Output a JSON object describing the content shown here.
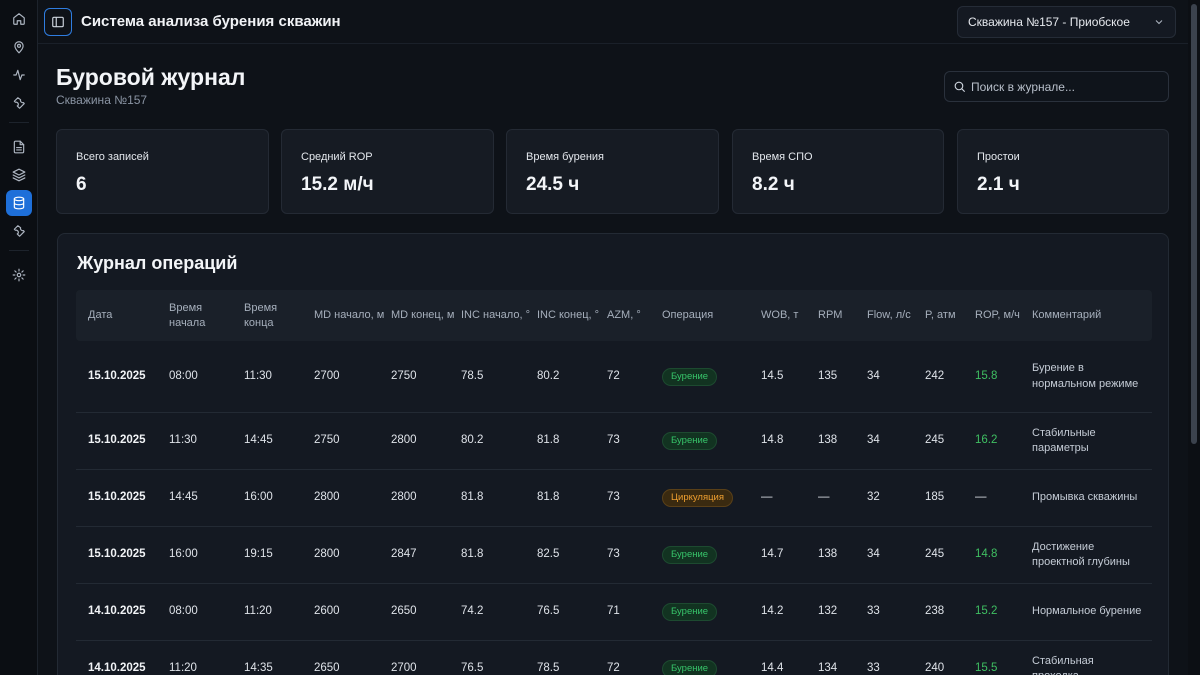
{
  "app": {
    "title": "Система анализа бурения скважин",
    "well_select": "Скважина №157 - Приобское"
  },
  "sidebar": {
    "items": [
      {
        "icon": "home-icon"
      },
      {
        "icon": "map-pin-icon"
      },
      {
        "icon": "activity-icon"
      },
      {
        "icon": "wrench-icon"
      },
      {
        "icon": "document-icon"
      },
      {
        "icon": "layers-icon"
      },
      {
        "icon": "database-icon",
        "active": true
      },
      {
        "icon": "wrench-icon"
      },
      {
        "icon": "gear-icon"
      }
    ]
  },
  "page": {
    "title": "Буровой журнал",
    "subtitle": "Скважина №157"
  },
  "search": {
    "placeholder": "Поиск в журнале..."
  },
  "stats": [
    {
      "label": "Всего записей",
      "value": "6"
    },
    {
      "label": "Средний ROP",
      "value": "15.2 м/ч"
    },
    {
      "label": "Время бурения",
      "value": "24.5 ч"
    },
    {
      "label": "Время СПО",
      "value": "8.2 ч"
    },
    {
      "label": "Простои",
      "value": "2.1 ч"
    }
  ],
  "journal": {
    "title": "Журнал операций",
    "columns": [
      "Дата",
      "Время начала",
      "Время конца",
      "MD начало, м",
      "MD конец, м",
      "INC начало, °",
      "INC конец, °",
      "AZM, °",
      "Операция",
      "WOB, т",
      "RPM",
      "Flow, л/с",
      "P, атм",
      "ROP, м/ч",
      "Комментарий"
    ],
    "rows": [
      {
        "date": "15.10.2025",
        "start": "08:00",
        "end": "11:30",
        "md_start": "2700",
        "md_end": "2750",
        "inc_start": "78.5",
        "inc_end": "80.2",
        "azm": "72",
        "operation": "Бурение",
        "op_color": "green",
        "wob": "14.5",
        "rpm": "135",
        "flow": "34",
        "p": "242",
        "rop": "15.8",
        "comment": "Бурение в нормальном режиме"
      },
      {
        "date": "15.10.2025",
        "start": "11:30",
        "end": "14:45",
        "md_start": "2750",
        "md_end": "2800",
        "inc_start": "80.2",
        "inc_end": "81.8",
        "azm": "73",
        "operation": "Бурение",
        "op_color": "green",
        "wob": "14.8",
        "rpm": "138",
        "flow": "34",
        "p": "245",
        "rop": "16.2",
        "comment": "Стабильные параметры"
      },
      {
        "date": "15.10.2025",
        "start": "14:45",
        "end": "16:00",
        "md_start": "2800",
        "md_end": "2800",
        "inc_start": "81.8",
        "inc_end": "81.8",
        "azm": "73",
        "operation": "Циркуляция",
        "op_color": "orange",
        "wob": "—",
        "rpm": "—",
        "flow": "32",
        "p": "185",
        "rop": "—",
        "comment": "Промывка скважины"
      },
      {
        "date": "15.10.2025",
        "start": "16:00",
        "end": "19:15",
        "md_start": "2800",
        "md_end": "2847",
        "inc_start": "81.8",
        "inc_end": "82.5",
        "azm": "73",
        "operation": "Бурение",
        "op_color": "green",
        "wob": "14.7",
        "rpm": "138",
        "flow": "34",
        "p": "245",
        "rop": "14.8",
        "comment": "Достижение проектной глубины"
      },
      {
        "date": "14.10.2025",
        "start": "08:00",
        "end": "11:20",
        "md_start": "2600",
        "md_end": "2650",
        "inc_start": "74.2",
        "inc_end": "76.5",
        "azm": "71",
        "operation": "Бурение",
        "op_color": "green",
        "wob": "14.2",
        "rpm": "132",
        "flow": "33",
        "p": "238",
        "rop": "15.2",
        "comment": "Нормальное бурение"
      },
      {
        "date": "14.10.2025",
        "start": "11:20",
        "end": "14:35",
        "md_start": "2650",
        "md_end": "2700",
        "inc_start": "76.5",
        "inc_end": "78.5",
        "azm": "72",
        "operation": "Бурение",
        "op_color": "green",
        "wob": "14.4",
        "rpm": "134",
        "flow": "33",
        "p": "240",
        "rop": "15.5",
        "comment": "Стабильная проходка"
      }
    ]
  }
}
